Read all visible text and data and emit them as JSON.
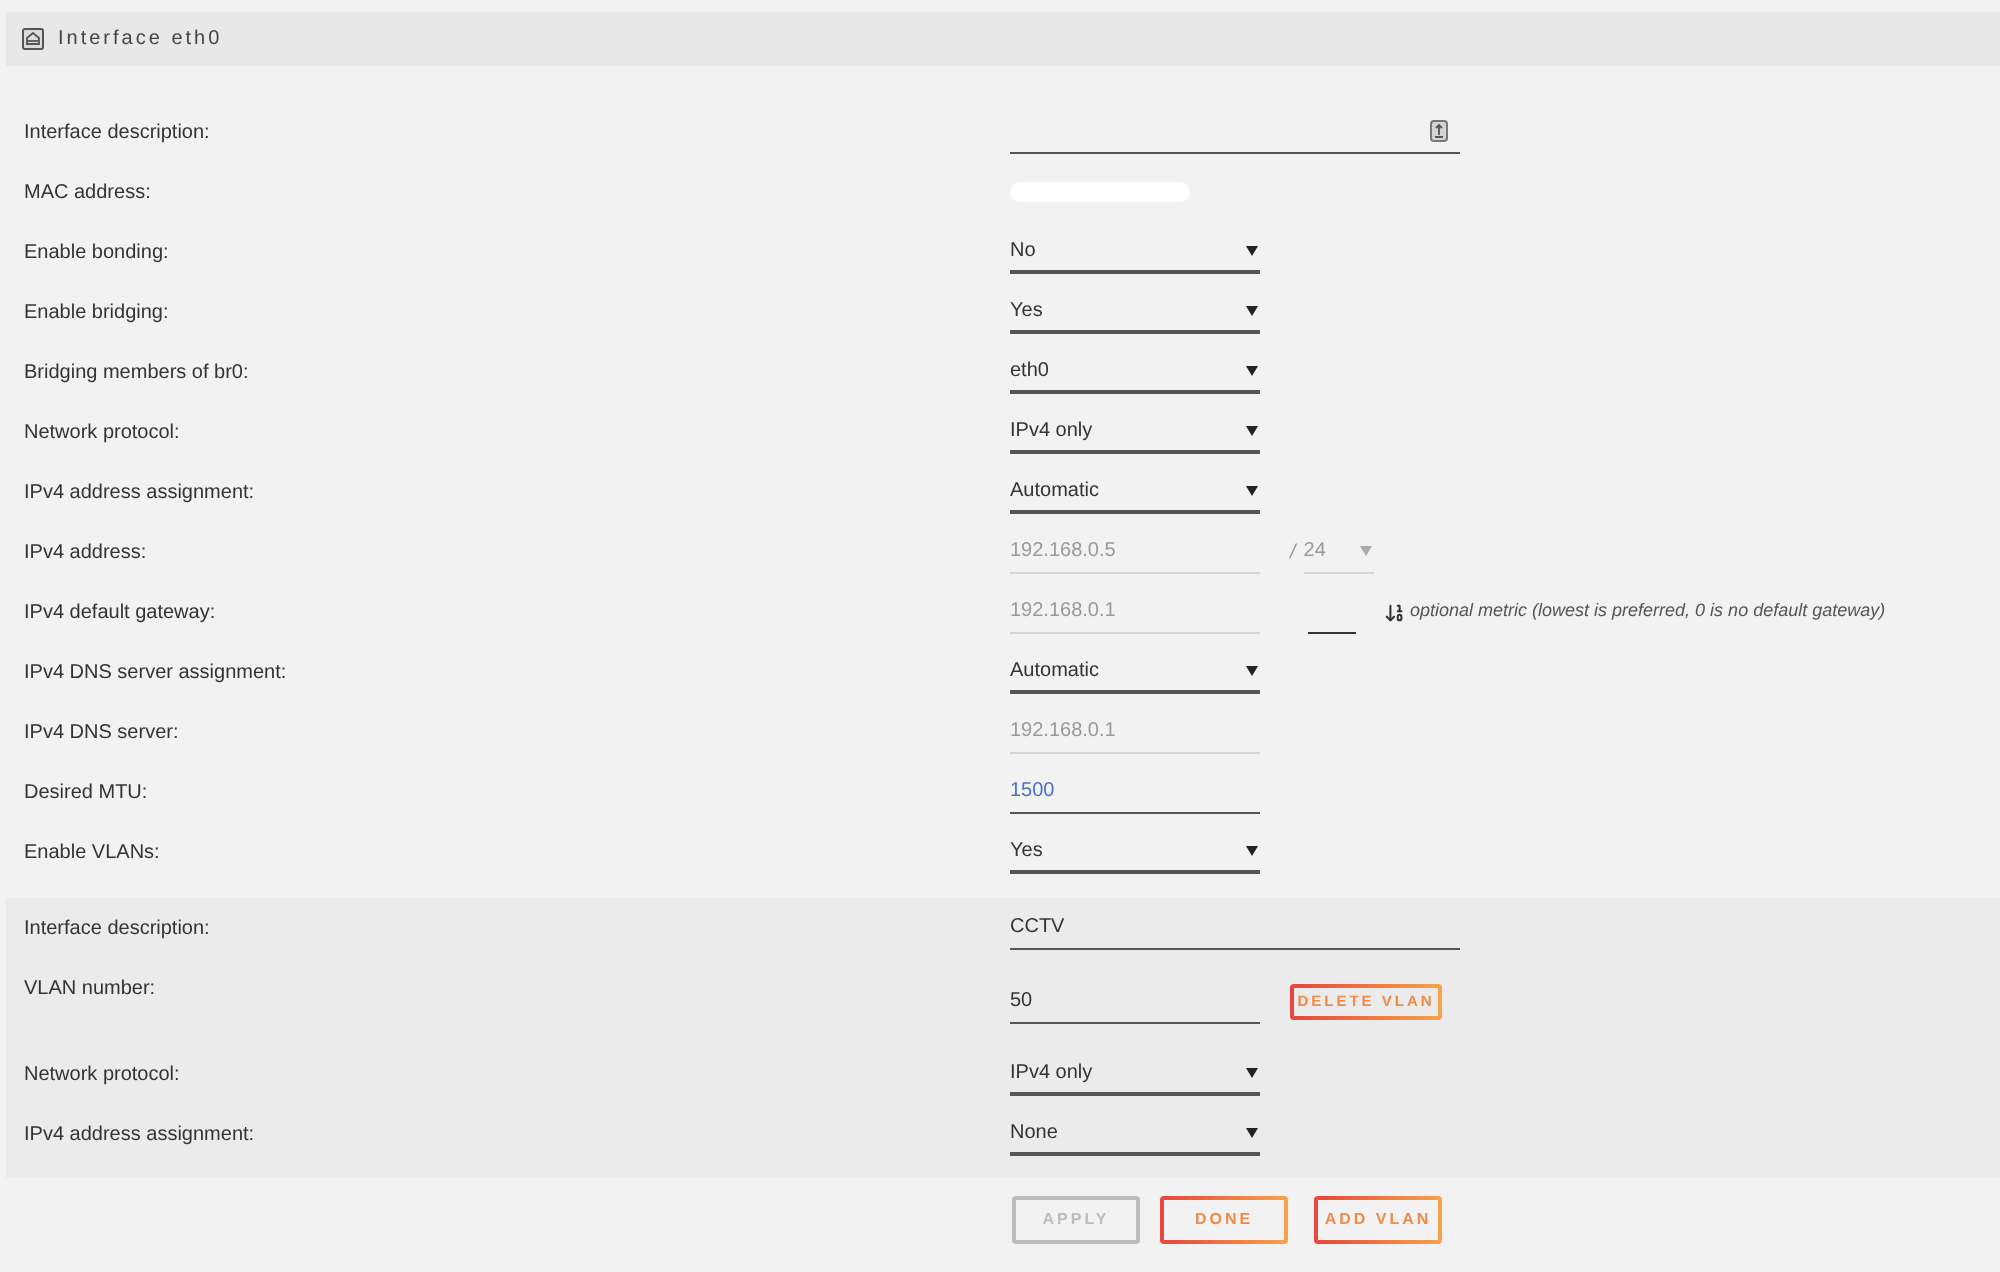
{
  "panel": {
    "title": "Interface eth0"
  },
  "fields": [
    {
      "label": "Interface description:",
      "kind": "text",
      "wide": true,
      "has_icon": true,
      "disabled": false
    },
    {
      "label": "MAC address:",
      "kind": "redacted"
    },
    {
      "label": "Enable bonding:",
      "kind": "select",
      "value": "No",
      "disabled": false
    },
    {
      "label": "Enable bridging:",
      "kind": "select",
      "value": "Yes",
      "disabled": false
    },
    {
      "label": "Bridging members of br0:",
      "kind": "select",
      "value": "eth0",
      "disabled": false
    },
    {
      "label": "Network protocol:",
      "kind": "select",
      "value": "IPv4 only",
      "disabled": false
    },
    {
      "label": "IPv4 address assignment:",
      "kind": "select",
      "value": "Automatic",
      "disabled": false
    },
    {
      "label": "IPv4 address:",
      "kind": "text",
      "value": "192.168.0.5",
      "disabled": true,
      "prefix": {
        "separator": "/",
        "value": "24",
        "disabled": true
      }
    },
    {
      "label": "IPv4 default gateway:",
      "kind": "text",
      "value": "192.168.0.1",
      "disabled": true,
      "metric": {
        "note": "optional metric (lowest is preferred, 0 is no default gateway)"
      }
    },
    {
      "label": "IPv4 DNS server assignment:",
      "kind": "select",
      "value": "Automatic",
      "disabled": false
    },
    {
      "label": "IPv4 DNS server:",
      "kind": "text",
      "value": "192.168.0.1",
      "disabled": true
    },
    {
      "label": "Desired MTU:",
      "kind": "text",
      "placeholder": "1500",
      "disabled": false
    },
    {
      "label": "Enable VLANs:",
      "kind": "select",
      "value": "Yes",
      "disabled": false
    }
  ],
  "vlan": {
    "fields": [
      {
        "label": "Interface description:",
        "kind": "text",
        "value": "CCTV",
        "wide": true,
        "disabled": false
      },
      {
        "label": "VLAN number:",
        "kind": "text",
        "value": "50",
        "disabled": false,
        "button": {
          "label": "DELETE VLAN"
        }
      },
      {
        "label": "Network protocol:",
        "kind": "select",
        "value": "IPv4 only",
        "disabled": false
      },
      {
        "label": "IPv4 address assignment:",
        "kind": "select",
        "value": "None",
        "disabled": false
      }
    ]
  },
  "buttons": [
    {
      "label": "APPLY",
      "disabled": true
    },
    {
      "label": "DONE",
      "disabled": false
    },
    {
      "label": "ADD VLAN",
      "disabled": false
    }
  ]
}
